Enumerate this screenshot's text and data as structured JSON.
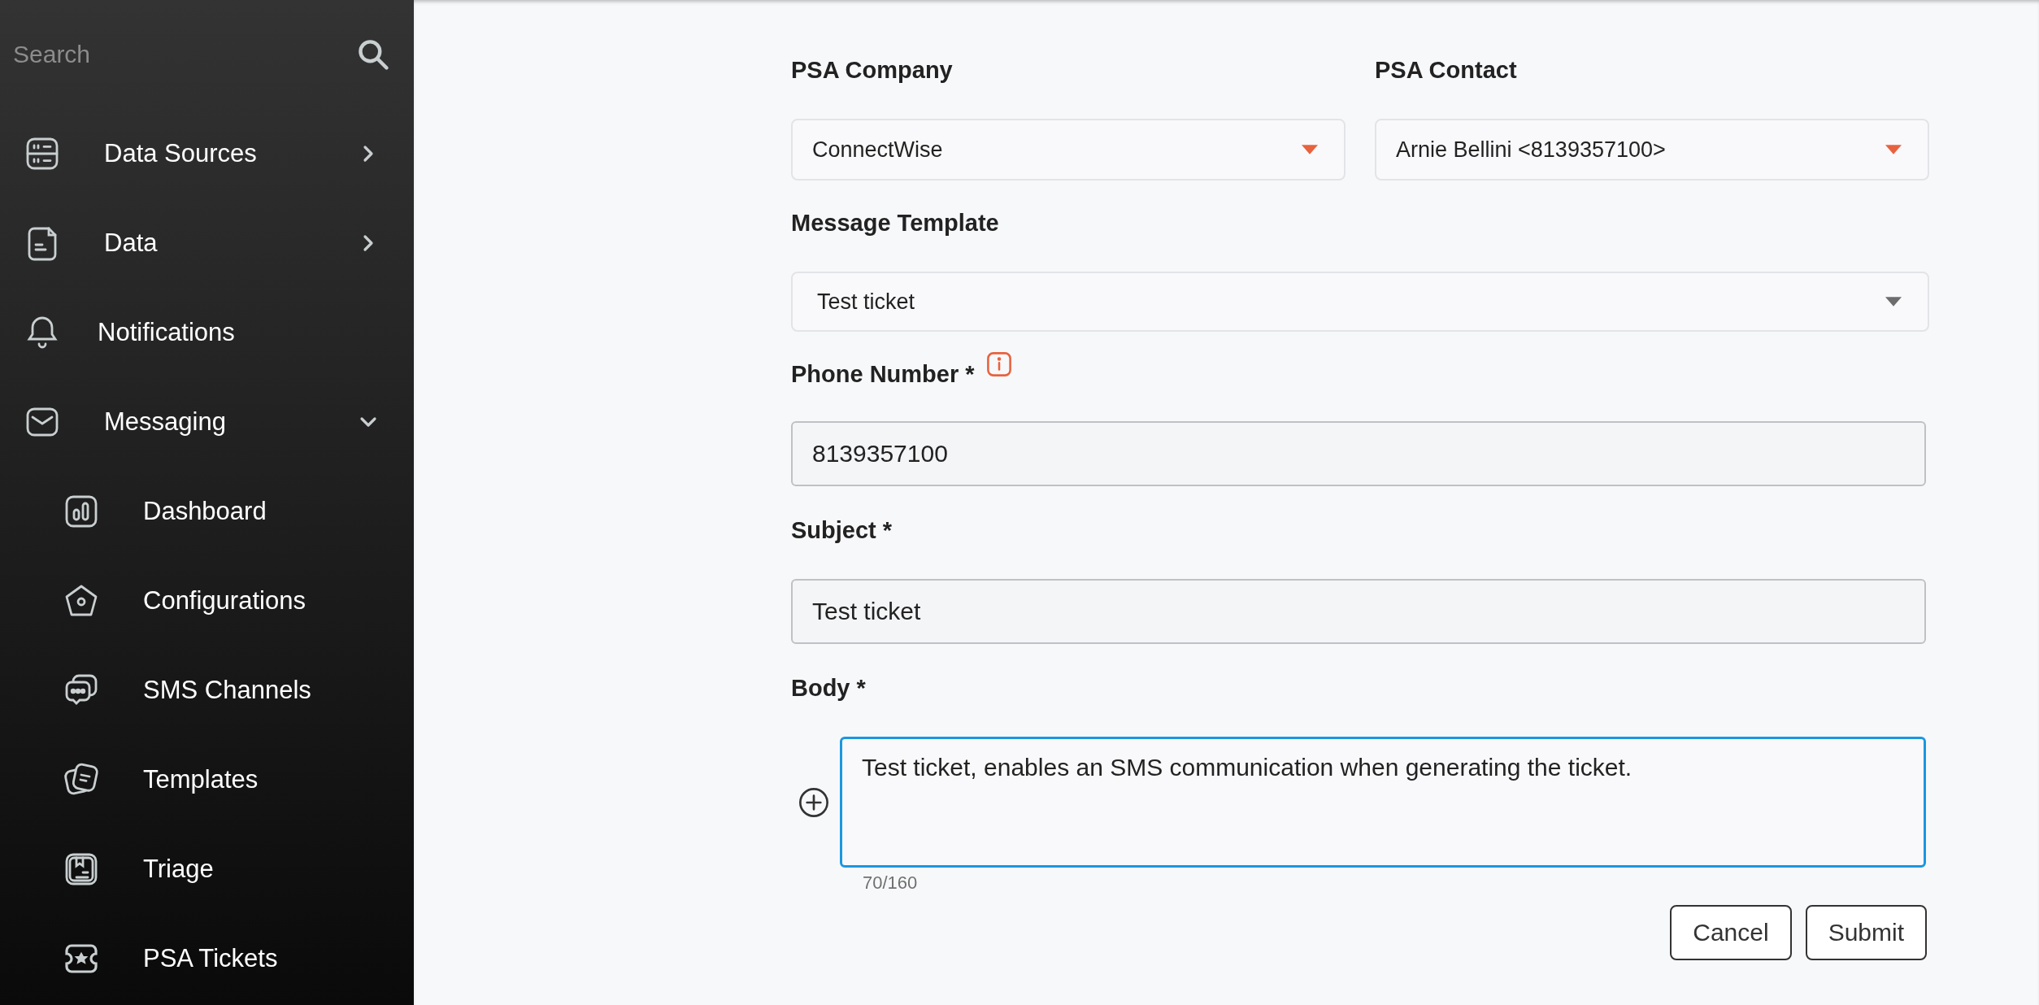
{
  "sidebar": {
    "search": {
      "placeholder": "Search"
    },
    "items": [
      {
        "label": "Data Sources",
        "expanded": false
      },
      {
        "label": "Data",
        "expanded": false
      },
      {
        "label": "Notifications"
      },
      {
        "label": "Messaging",
        "expanded": true,
        "children": [
          {
            "label": "Dashboard"
          },
          {
            "label": "Configurations"
          },
          {
            "label": "SMS Channels"
          },
          {
            "label": "Templates"
          },
          {
            "label": "Triage"
          },
          {
            "label": "PSA Tickets"
          }
        ]
      }
    ]
  },
  "form": {
    "psa_company": {
      "label": "PSA Company",
      "value": "ConnectWise"
    },
    "psa_contact": {
      "label": "PSA Contact",
      "value": "Arnie Bellini <8139357100>"
    },
    "message_template": {
      "label": "Message Template",
      "value": "Test ticket"
    },
    "phone_number": {
      "label": "Phone Number *",
      "value": "8139357100"
    },
    "subject": {
      "label": "Subject *",
      "value": "Test ticket"
    },
    "body": {
      "label": "Body *",
      "value": "Test ticket, enables an SMS communication when generating the ticket.",
      "focused": true,
      "counter": "70/160"
    },
    "buttons": [
      "Cancel",
      "Submit"
    ]
  }
}
